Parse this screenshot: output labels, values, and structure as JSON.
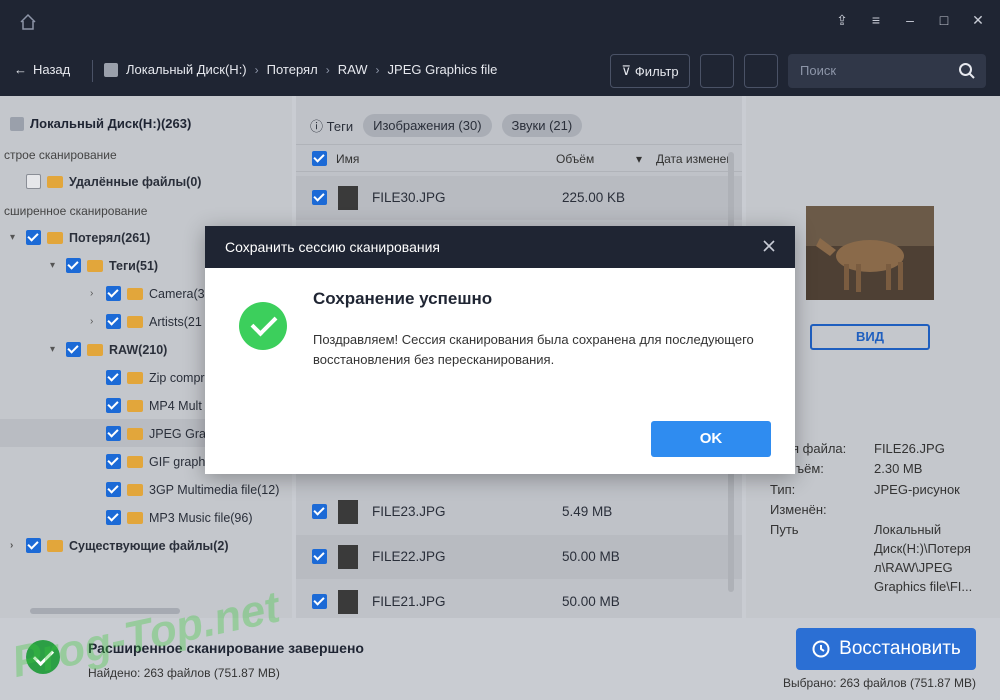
{
  "nav": {
    "back_label": "Назад",
    "breadcrumbs": [
      "Локальный Диск(H:)",
      "Потерял",
      "RAW",
      "JPEG Graphics file"
    ],
    "filter_label": "Фильтр",
    "search_placeholder": "Поиск"
  },
  "tree": {
    "root": "Локальный Диск(H:)(263)",
    "section_quick": "стрoе сканирование",
    "deleted": "Удалённые файлы(0)",
    "section_advanced": "сширенное сканирование",
    "lost": "Потерял(261)",
    "tags": "Теги(51)",
    "camera": "Camera(3",
    "artists": "Artists(21",
    "raw": "RAW(210)",
    "zip": "Zip compr",
    "mp4": "MP4 Mult",
    "jpeg": "JPEG Grap",
    "gif": "GIF graph",
    "gp3": "3GP Multimedia file(12)",
    "mp3": "MP3 Music file(96)",
    "existing": "Существующие файлы(2)"
  },
  "filters": {
    "tags": "Теги",
    "images": "Изображения (30)",
    "sounds": "Звуки (21)"
  },
  "table": {
    "col_name": "Имя",
    "col_size": "Объём",
    "col_date": "Дата изменен",
    "rows": [
      {
        "name": "FILE30.JPG",
        "size": "225.00 KB"
      },
      {
        "name": "FILE23.JPG",
        "size": "5.49 MB"
      },
      {
        "name": "FILE22.JPG",
        "size": "50.00 MB"
      },
      {
        "name": "FILE21.JPG",
        "size": "50.00 MB"
      }
    ]
  },
  "details": {
    "view_button": "ВИД",
    "name_label": "я файла:",
    "name_value": "FILE26.JPG",
    "size_label": "ъём:",
    "size_value": "2.30 MB",
    "type_label": "Тип:",
    "type_value": "JPEG-рисунок",
    "modified_label": "Изменён:",
    "path_label": "Путь",
    "path_value_1": "Локальный",
    "path_value_2": "Диск(H:)\\Потеря",
    "path_value_3": "л\\RAW\\JPEG",
    "path_value_4": "Graphics file\\FI..."
  },
  "status": {
    "title": "Расширенное сканирование завершено",
    "found": "Найдено: 263 файлов (751.87 MB)",
    "recover_button": "Восстановить",
    "selected": "Выбрано: 263 файлов  (751.87 MB)",
    "watermark": "Prog-Top.net"
  },
  "modal": {
    "header": "Сохранить сессию сканирования",
    "title": "Сохранение успешно",
    "text": "Поздравляем! Сессия сканирования была сохранена для последующего восстановления без пересканирования.",
    "ok": "OK"
  },
  "colors": {
    "dark_bar": "#1f2533",
    "accent_blue": "#2f8cf0",
    "success_green": "#3ccf5c"
  }
}
